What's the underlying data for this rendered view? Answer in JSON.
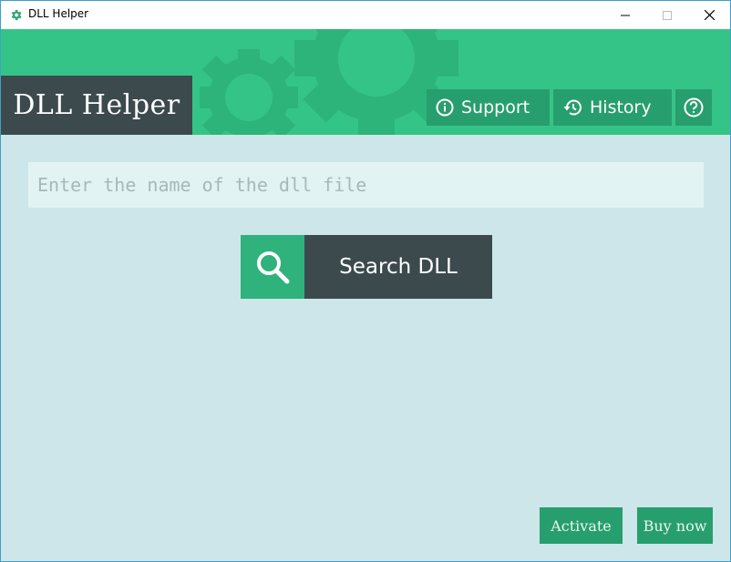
{
  "window": {
    "title": "DLL Helper"
  },
  "header": {
    "brand": "DLL Helper",
    "support_label": "Support",
    "history_label": "History",
    "help_icon": "question-circle-icon"
  },
  "search": {
    "placeholder": "Enter the name of the dll file",
    "value": "",
    "button_label": "Search DLL"
  },
  "footer": {
    "activate_label": "Activate",
    "buy_label": "Buy now"
  },
  "colors": {
    "header_green": "#35c487",
    "button_green": "#279e6e",
    "dark_slate": "#3c4a4e",
    "background": "#cde6ea"
  }
}
